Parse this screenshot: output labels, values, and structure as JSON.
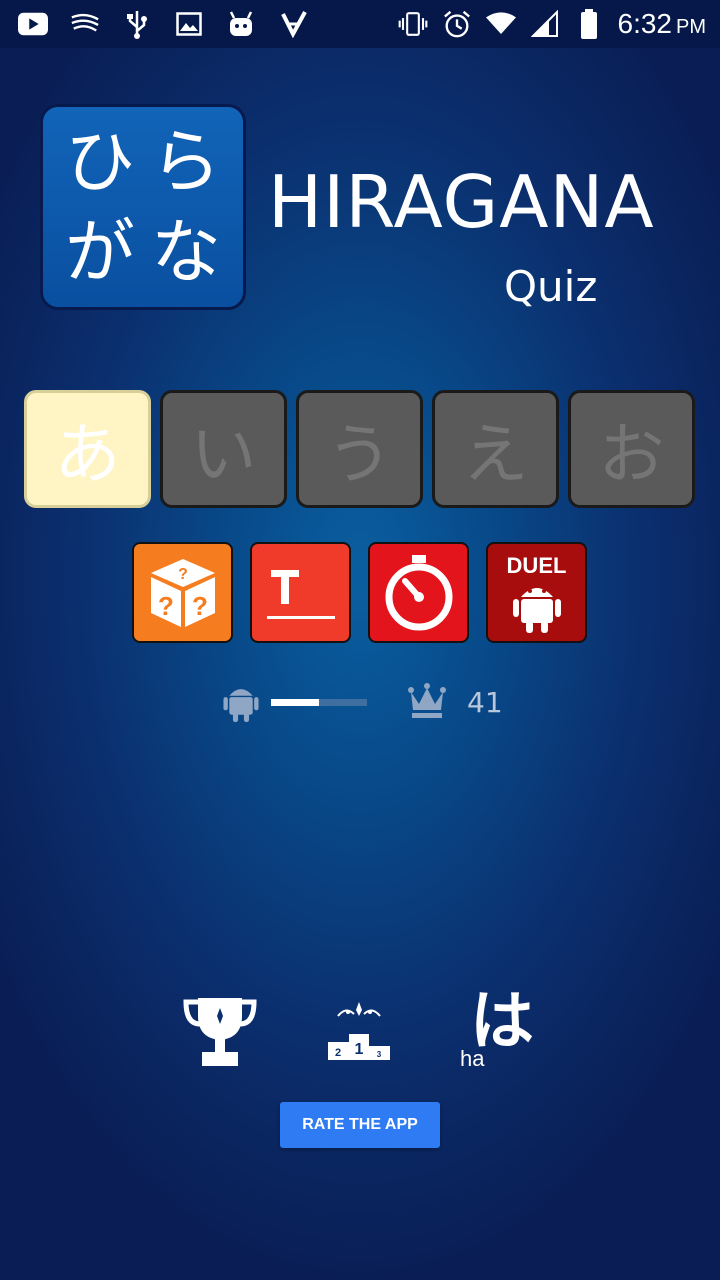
{
  "status_bar": {
    "time": "6:32",
    "ampm": "PM",
    "left_icons": [
      "youtube-icon",
      "swiftkey-icon",
      "usb-icon",
      "image-icon",
      "android-debug-icon",
      "tasks-icon"
    ],
    "right_icons": [
      "vibrate-icon",
      "alarm-icon",
      "wifi-icon",
      "signal-icon",
      "battery-icon"
    ]
  },
  "logo": {
    "kana": [
      "ひ",
      "ら",
      "が",
      "な"
    ],
    "title": "HIRAGANA",
    "subtitle": "Quiz"
  },
  "kana_selector": [
    {
      "char": "あ",
      "active": true
    },
    {
      "char": "い",
      "active": false
    },
    {
      "char": "う",
      "active": false
    },
    {
      "char": "え",
      "active": false
    },
    {
      "char": "お",
      "active": false
    }
  ],
  "modes": {
    "duel_label": "DUEL"
  },
  "progress": {
    "fraction": 0.5,
    "score": "41"
  },
  "rate_button": "RATE THE APP",
  "bottom": {
    "kana": "は",
    "romaji": "ha"
  },
  "colors": {
    "background": "#084a8a",
    "active_kana": "#fff4c4",
    "inactive_kana": "#5a5a5a",
    "random_mode": "#f57c1f",
    "text_mode": "#f03a2a",
    "timer_mode": "#e3141b",
    "duel_mode": "#a80d0d",
    "rate_button": "#2f7bf4"
  }
}
